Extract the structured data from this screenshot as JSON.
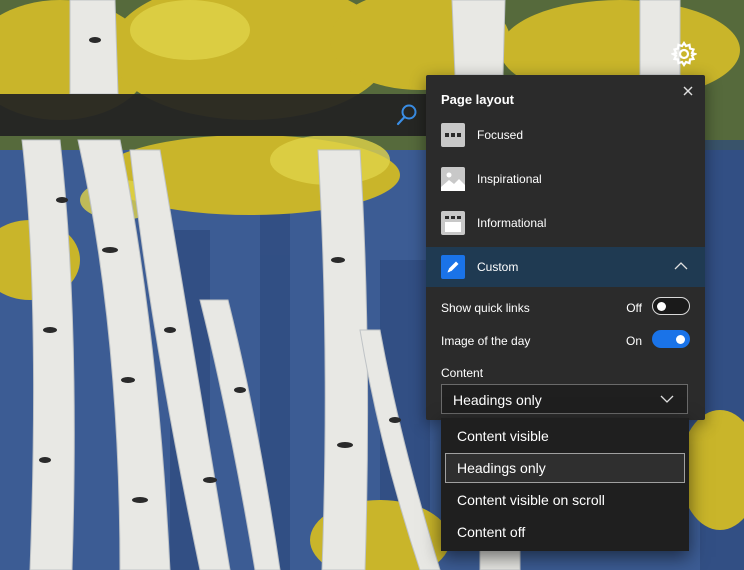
{
  "wallpaper": {
    "description_icon": "aspen-trees-image"
  },
  "search": {
    "icon": "search-icon"
  },
  "settings": {
    "icon": "gear-icon"
  },
  "panel": {
    "title": "Page layout",
    "close_icon": "close-icon",
    "layouts": [
      {
        "label": "Focused",
        "icon": "focused-layout-icon",
        "selected": false
      },
      {
        "label": "Inspirational",
        "icon": "inspirational-layout-icon",
        "selected": false
      },
      {
        "label": "Informational",
        "icon": "informational-layout-icon",
        "selected": false
      },
      {
        "label": "Custom",
        "icon": "pencil-icon",
        "selected": true
      }
    ],
    "quick_links": {
      "label": "Show quick links",
      "state_text": "Off",
      "on": false
    },
    "image_of_day": {
      "label": "Image of the day",
      "state_text": "On",
      "on": true
    },
    "content": {
      "label": "Content",
      "value": "Headings only"
    }
  },
  "dropdown": {
    "options": [
      "Content visible",
      "Headings only",
      "Content visible on scroll",
      "Content off"
    ],
    "selected_index": 1
  },
  "colors": {
    "accent": "#1a73e8",
    "panel_bg": "#2b2b2b",
    "selected_row_bg": "#1f3a52"
  }
}
